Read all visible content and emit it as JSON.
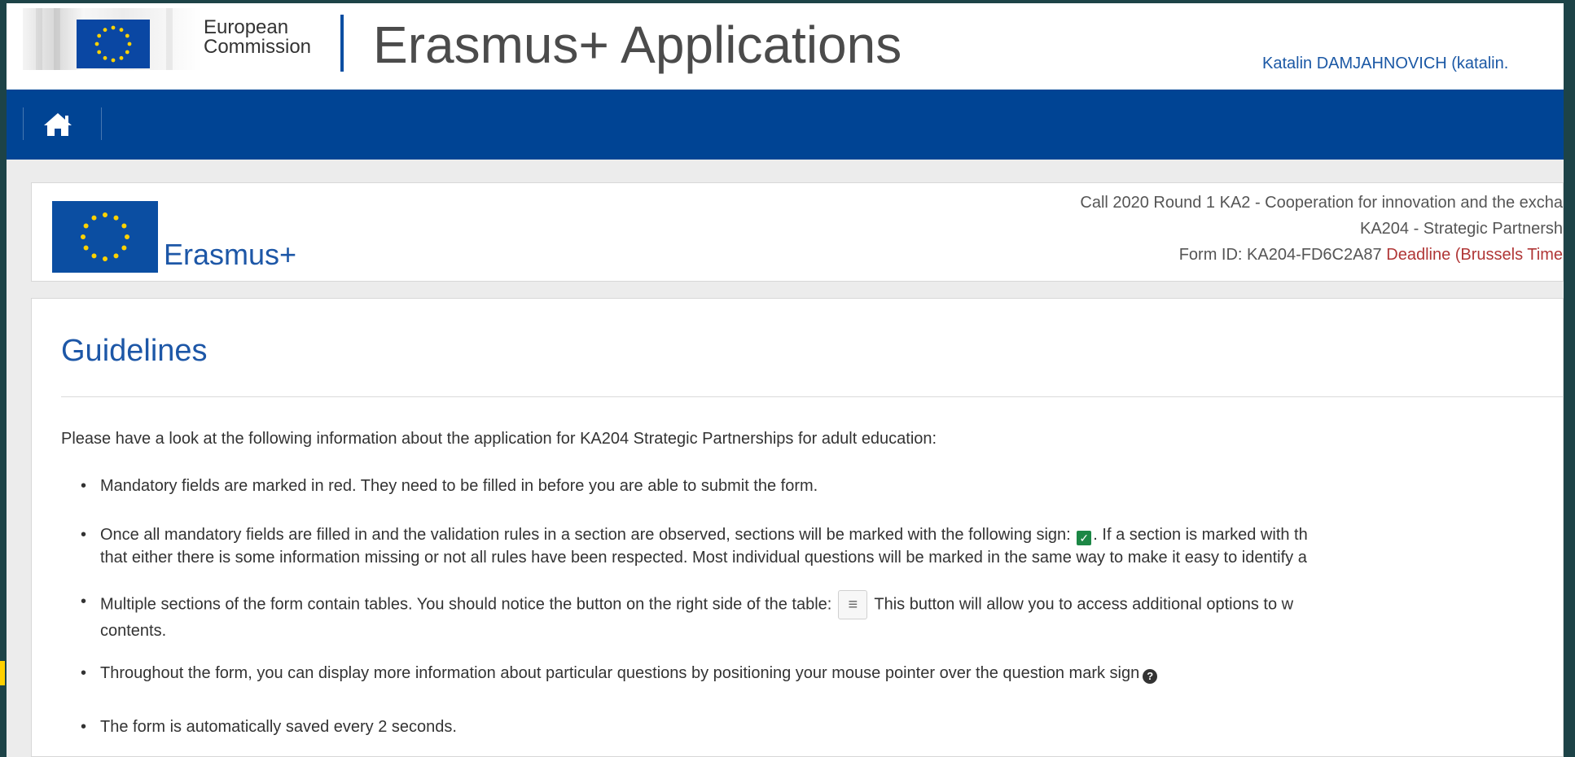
{
  "header": {
    "organization_line_1": "European",
    "organization_line_2": "Commission",
    "app_title": "Erasmus+ Applications",
    "user_name": "Katalin DAMJAHNOVICH (katalin."
  },
  "navigation": {
    "home_icon": "home-icon"
  },
  "info_panel": {
    "programme_label": "Erasmus+",
    "call_line": "Call 2020  Round 1  KA2 - Cooperation for innovation and the excha",
    "action_line": "KA204 - Strategic Partnersh",
    "form_id": "Form ID: KA204-FD6C2A87",
    "deadline": "Deadline (Brussels Time"
  },
  "guidelines": {
    "title": "Guidelines",
    "intro": "Please have a look at the following information about the application for KA204 Strategic Partnerships for adult education:",
    "bullets": {
      "mandatory_fields": "Mandatory fields are marked in red. They need to be filled in before you are able to submit the form.",
      "validation_before_check": "Once all mandatory fields are filled in and the validation rules in a section are observed, sections will be marked with the following sign: ",
      "validation_after_check": ". If a section is marked with th",
      "validation_second_line": "that either there is some information missing or not all rules have been respected. Most individual questions will be marked in the same way to make it easy to identify a",
      "tables_before_button": "Multiple sections of the form contain tables. You should notice the button on the right side of the table:",
      "tables_after_button": "This button will allow you to access additional options to w",
      "tables_second_line": "contents.",
      "help": "Throughout the form, you can display more information about particular questions by positioning your mouse pointer over the question mark sign",
      "autosave": "The form is automatically saved every 2 seconds."
    },
    "icons": {
      "check": "check-icon",
      "menu": "menu-icon",
      "question": "question-mark-icon"
    }
  },
  "colors": {
    "outer_background": "#1d4347",
    "navigation_blue": "#004494",
    "link_blue": "#1d57a7",
    "deadline_red": "#b03636",
    "success_green": "#1c8745",
    "accent_yellow": "#ffd100"
  }
}
